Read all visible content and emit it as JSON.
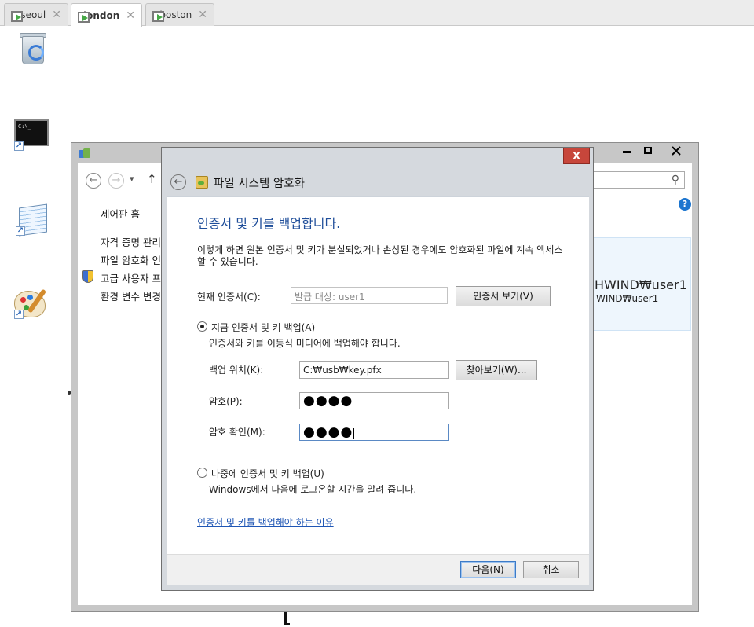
{
  "tabs": [
    {
      "label": "seoul",
      "active": false
    },
    {
      "label": "london",
      "active": true
    },
    {
      "label": "boston",
      "active": false
    }
  ],
  "tab_close_glyph": "✕",
  "desktop_icons": [
    "recycle-bin-icon",
    "command-prompt-icon",
    "notepad-icon",
    "paint-icon"
  ],
  "cmd_prompt_text": "C:\\_",
  "control_panel": {
    "back_glyph": "←",
    "forward_glyph": "→",
    "dropdown_glyph": "▾",
    "up_glyph": "↑",
    "help_glyph": "?",
    "side_links": [
      "제어판 홈",
      "자격 증명 관리",
      "파일 암호화 인",
      "고급 사용자 프",
      "환경 변수 변경"
    ],
    "user_line1": "HWIND₩user1",
    "user_line2": "WIND₩user1"
  },
  "dialog": {
    "close_glyph": "x",
    "back_glyph": "←",
    "title": "파일 시스템 암호화",
    "heading": "인증서 및 키를 백업합니다.",
    "description": "이렇게 하면 원본 인증서 및 키가 분실되었거나 손상된 경우에도 암호화된 파일에 계속 액세스할 수 있습니다.",
    "current_cert_label": "현재 인증서(C):",
    "current_cert_value": "발급 대상: user1",
    "view_cert_button": "인증서 보기(V)",
    "option_now": {
      "label": "지금 인증서 및 키 백업(A)",
      "hint": "인증서와 키를 이동식 미디어에 백업해야 합니다.",
      "selected": true
    },
    "backup_location_label": "백업 위치(K):",
    "backup_location_value": "C:₩usb₩key.pfx",
    "browse_button": "찾아보기(W)...",
    "password_label": "암호(P):",
    "password_value": "●●●●",
    "confirm_label": "암호 확인(M):",
    "confirm_value": "●●●●",
    "option_later": {
      "label": "나중에 인증서 및 키 백업(U)",
      "hint": "Windows에서 다음에 로그온할 시간을 알려 줍니다.",
      "selected": false
    },
    "why_link": "인증서 및 키를 백업해야 하는 이유",
    "next_button": "다음(N)",
    "cancel_button": "취소"
  }
}
